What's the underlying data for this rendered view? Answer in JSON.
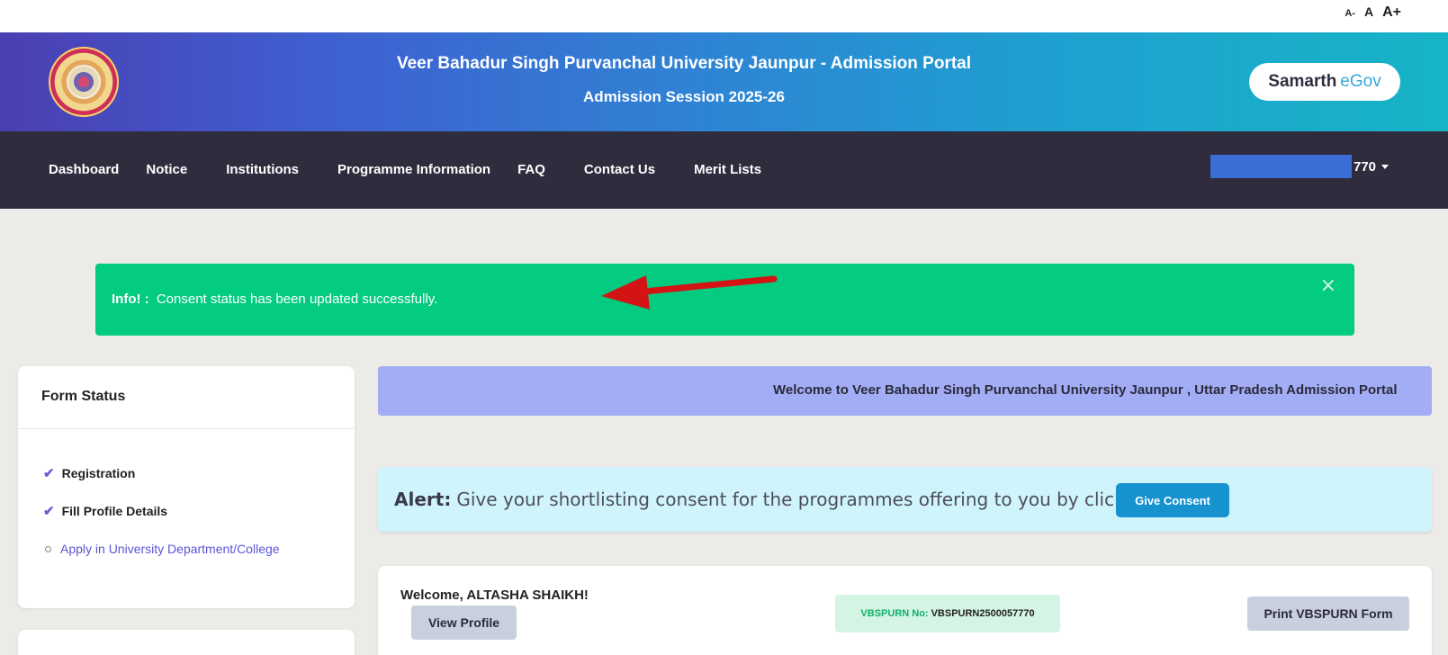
{
  "font_controls": {
    "small": "A-",
    "normal": "A",
    "large": "A+"
  },
  "header": {
    "title": "Veer Bahadur Singh Purvanchal University Jaunpur - Admission Portal",
    "subtitle": "Admission Session 2025-26",
    "brand_a": "Samarth",
    "brand_b": "eGov",
    "logo_icon": "university-seal"
  },
  "nav": {
    "items": [
      "Dashboard",
      "Notice",
      "Institutions",
      "Programme Information",
      "FAQ",
      "Contact Us",
      "Merit Lists"
    ],
    "user_suffix": "770"
  },
  "info_alert": {
    "label": "Info! :",
    "message": "Consent status has been updated successfully.",
    "close": "×"
  },
  "form_status": {
    "title": "Form Status",
    "steps": [
      {
        "label": "Registration",
        "done": true
      },
      {
        "label": "Fill Profile Details",
        "done": true
      },
      {
        "label": "Apply in University Department/College",
        "done": false
      }
    ]
  },
  "marquee": {
    "text": "Welcome to Veer Bahadur Singh Purvanchal University Jaunpur , Uttar Pradesh Admission Portal"
  },
  "alert": {
    "label": "Alert:",
    "message": "Give your shortlisting consent for the programmes offering to you by clicking",
    "button": "Give Consent"
  },
  "welcome": {
    "greeting": "Welcome, ALTASHA SHAIKH!",
    "view_profile": "View Profile",
    "vbspurn_label": "VBSPURN No:",
    "vbspurn_value": "VBSPURN2500057770",
    "print_button": "Print VBSPURN Form"
  },
  "colors": {
    "header_start": "#4b3fb2",
    "header_end": "#17b4c7",
    "navbar": "#2f2c3e",
    "success": "#03cb7f",
    "marquee": "#a3adf5",
    "alert": "#cff4fb",
    "consent_button": "#1692cf"
  }
}
